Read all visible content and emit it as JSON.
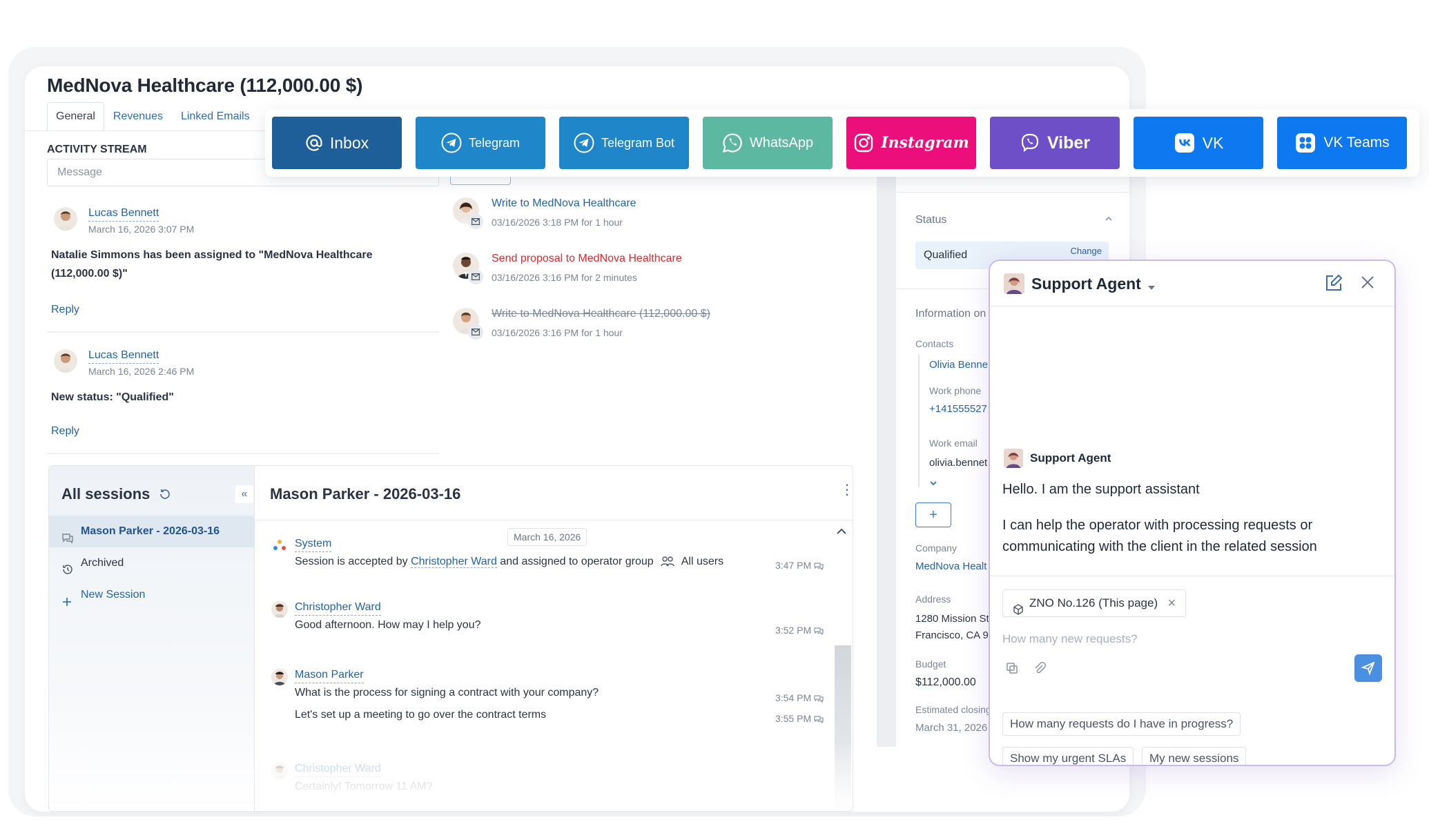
{
  "record": {
    "title": "MedNova Healthcare (112,000.00 $)",
    "tabs": [
      "General",
      "Revenues",
      "Linked Emails"
    ],
    "activity_stream_label": "ACTIVITY STREAM",
    "message_placeholder": "Message"
  },
  "stream": [
    {
      "name": "Lucas Bennett",
      "time": "March 16, 2026 3:07 PM",
      "text": "Natalie Simmons has been assigned to \"MedNova Healthcare (112,000.00 $)\"",
      "reply": "Reply"
    },
    {
      "name": "Lucas Bennett",
      "time": "March 16, 2026 2:46 PM",
      "text": "New status: \"Qualified\"",
      "reply": "Reply"
    }
  ],
  "activities": [
    {
      "title": "Write to MedNova Healthcare",
      "time": "03/16/2026 3:18 PM for 1 hour",
      "style": "link"
    },
    {
      "title": "Send proposal to MedNova Healthcare",
      "time": "03/16/2026 3:16 PM for 2 minutes",
      "style": "red"
    },
    {
      "title": "Write to MedNova Healthcare (112,000.00 $)",
      "time": "03/16/2026 3:16 PM for 1 hour",
      "style": "strike"
    }
  ],
  "side": {
    "status_label": "Status",
    "status_value": "Qualified",
    "status_change": "Change",
    "info_label": "Information on",
    "contacts_label": "Contacts",
    "contact_name": "Olivia Benne",
    "work_phone_label": "Work phone",
    "work_phone": "+141555527",
    "work_email_label": "Work email",
    "work_email": "olivia.bennet",
    "plus": "+",
    "company_label": "Company",
    "company": "MedNova Healt",
    "address_label": "Address",
    "address_1": "1280 Mission St",
    "address_2": "Francisco, CA 9",
    "budget_label": "Budget",
    "budget": "$112,000.00",
    "closing_label": "Estimated closing",
    "closing": "March 31, 2026"
  },
  "sessions": {
    "title": "All sessions",
    "items": [
      {
        "label": "Mason Parker - 2026-03-16",
        "state": "active"
      },
      {
        "label": "Archived",
        "state": "normal"
      },
      {
        "label": "New Session",
        "state": "link"
      }
    ],
    "chat_title": "Mason Parker - 2026-03-16",
    "date_chip": "March 16, 2026",
    "messages": [
      {
        "author": "System",
        "pre": "Session is accepted by ",
        "link": "Christopher Ward",
        "post": " and assigned to operator group",
        "group": "All users",
        "time": "3:47 PM"
      },
      {
        "author": "Christopher Ward",
        "text": "Good afternoon. How may I help you?",
        "time": "3:52 PM"
      },
      {
        "author": "Mason Parker",
        "text": "What is the process for signing a contract with your company?",
        "time": "3:54 PM",
        "text2": "Let's set up a meeting to go over the contract terms",
        "time2": "3:55 PM"
      },
      {
        "author": "Christopher Ward",
        "text": "Certainly! Tomorrow 11 AM?"
      }
    ]
  },
  "channels": [
    {
      "label": "Inbox",
      "color": "#1f5f99",
      "icon": "at-icon"
    },
    {
      "label": "Telegram",
      "color": "#1e86c9",
      "icon": "telegram-icon"
    },
    {
      "label": "Telegram Bot",
      "color": "#1e86c9",
      "icon": "telegram-icon"
    },
    {
      "label": "WhatsApp",
      "color": "#5cb8a0",
      "icon": "whatsapp-icon"
    },
    {
      "label": "Instagram",
      "color": "#ec0f7b",
      "icon": "instagram-icon"
    },
    {
      "label": "Viber",
      "color": "#6f4fc8",
      "icon": "viber-icon"
    },
    {
      "label": "VK",
      "color": "#0d78f0",
      "icon": "vk-icon"
    },
    {
      "label": "VK Teams",
      "color": "#0d78f0",
      "icon": "vk-teams-icon"
    }
  ],
  "agent": {
    "title": "Support Agent",
    "from": "Support Agent",
    "msg1": "Hello. I am the support assistant",
    "msg2": "I can help the operator with processing requests or communicating with the client in the related session",
    "context_chip": "ZNO No.126 (This page)",
    "input_placeholder": "How many new requests?",
    "suggestions": [
      "How many requests do I have in progress?",
      "Show my urgent SLAs",
      "My new sessions"
    ]
  }
}
